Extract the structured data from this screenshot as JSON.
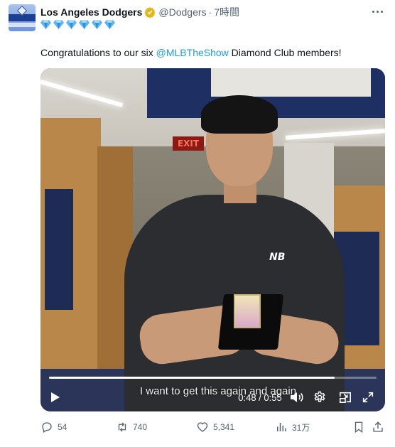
{
  "tweet": {
    "display_name": "Los Angeles Dodgers",
    "handle": "@Dodgers",
    "separator": "·",
    "time": "7時間",
    "diamond_emoji_count": 6,
    "text_before": "Congratulations to our six ",
    "mention": "@MLBTheShow",
    "text_after": " Diamond Club members!"
  },
  "video": {
    "subtitle": "I want to get this again and again",
    "timecode": "0:48 / 0:55",
    "progress_fraction": 0.873,
    "exit_sign": "EXIT"
  },
  "actions": {
    "replies": "54",
    "retweets": "740",
    "likes": "5,341",
    "views": "31万"
  },
  "colors": {
    "accent": "#1d9bf0",
    "muted": "#536471",
    "text": "#0f1419",
    "verified_gold": "#e2b719"
  }
}
